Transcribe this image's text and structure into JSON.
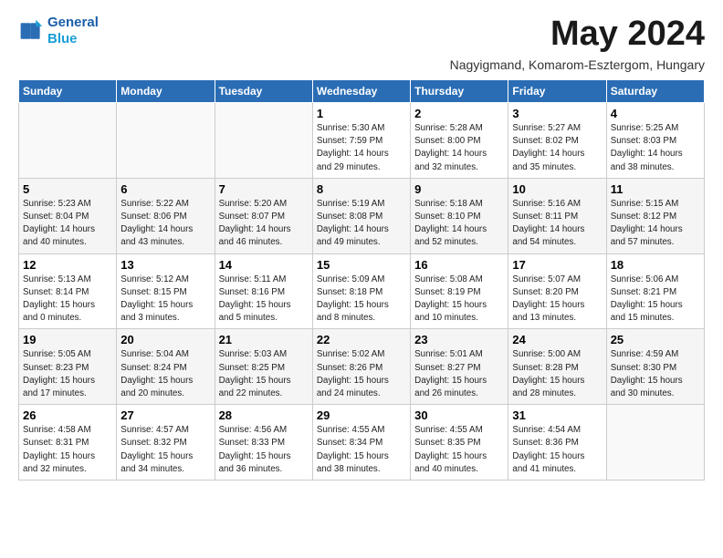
{
  "header": {
    "logo_line1": "General",
    "logo_line2": "Blue",
    "title": "May 2024",
    "subtitle": "Nagyigmand, Komarom-Esztergom, Hungary"
  },
  "days_of_week": [
    "Sunday",
    "Monday",
    "Tuesday",
    "Wednesday",
    "Thursday",
    "Friday",
    "Saturday"
  ],
  "weeks": [
    [
      {
        "day": "",
        "info": ""
      },
      {
        "day": "",
        "info": ""
      },
      {
        "day": "",
        "info": ""
      },
      {
        "day": "1",
        "info": "Sunrise: 5:30 AM\nSunset: 7:59 PM\nDaylight: 14 hours\nand 29 minutes."
      },
      {
        "day": "2",
        "info": "Sunrise: 5:28 AM\nSunset: 8:00 PM\nDaylight: 14 hours\nand 32 minutes."
      },
      {
        "day": "3",
        "info": "Sunrise: 5:27 AM\nSunset: 8:02 PM\nDaylight: 14 hours\nand 35 minutes."
      },
      {
        "day": "4",
        "info": "Sunrise: 5:25 AM\nSunset: 8:03 PM\nDaylight: 14 hours\nand 38 minutes."
      }
    ],
    [
      {
        "day": "5",
        "info": "Sunrise: 5:23 AM\nSunset: 8:04 PM\nDaylight: 14 hours\nand 40 minutes."
      },
      {
        "day": "6",
        "info": "Sunrise: 5:22 AM\nSunset: 8:06 PM\nDaylight: 14 hours\nand 43 minutes."
      },
      {
        "day": "7",
        "info": "Sunrise: 5:20 AM\nSunset: 8:07 PM\nDaylight: 14 hours\nand 46 minutes."
      },
      {
        "day": "8",
        "info": "Sunrise: 5:19 AM\nSunset: 8:08 PM\nDaylight: 14 hours\nand 49 minutes."
      },
      {
        "day": "9",
        "info": "Sunrise: 5:18 AM\nSunset: 8:10 PM\nDaylight: 14 hours\nand 52 minutes."
      },
      {
        "day": "10",
        "info": "Sunrise: 5:16 AM\nSunset: 8:11 PM\nDaylight: 14 hours\nand 54 minutes."
      },
      {
        "day": "11",
        "info": "Sunrise: 5:15 AM\nSunset: 8:12 PM\nDaylight: 14 hours\nand 57 minutes."
      }
    ],
    [
      {
        "day": "12",
        "info": "Sunrise: 5:13 AM\nSunset: 8:14 PM\nDaylight: 15 hours\nand 0 minutes."
      },
      {
        "day": "13",
        "info": "Sunrise: 5:12 AM\nSunset: 8:15 PM\nDaylight: 15 hours\nand 3 minutes."
      },
      {
        "day": "14",
        "info": "Sunrise: 5:11 AM\nSunset: 8:16 PM\nDaylight: 15 hours\nand 5 minutes."
      },
      {
        "day": "15",
        "info": "Sunrise: 5:09 AM\nSunset: 8:18 PM\nDaylight: 15 hours\nand 8 minutes."
      },
      {
        "day": "16",
        "info": "Sunrise: 5:08 AM\nSunset: 8:19 PM\nDaylight: 15 hours\nand 10 minutes."
      },
      {
        "day": "17",
        "info": "Sunrise: 5:07 AM\nSunset: 8:20 PM\nDaylight: 15 hours\nand 13 minutes."
      },
      {
        "day": "18",
        "info": "Sunrise: 5:06 AM\nSunset: 8:21 PM\nDaylight: 15 hours\nand 15 minutes."
      }
    ],
    [
      {
        "day": "19",
        "info": "Sunrise: 5:05 AM\nSunset: 8:23 PM\nDaylight: 15 hours\nand 17 minutes."
      },
      {
        "day": "20",
        "info": "Sunrise: 5:04 AM\nSunset: 8:24 PM\nDaylight: 15 hours\nand 20 minutes."
      },
      {
        "day": "21",
        "info": "Sunrise: 5:03 AM\nSunset: 8:25 PM\nDaylight: 15 hours\nand 22 minutes."
      },
      {
        "day": "22",
        "info": "Sunrise: 5:02 AM\nSunset: 8:26 PM\nDaylight: 15 hours\nand 24 minutes."
      },
      {
        "day": "23",
        "info": "Sunrise: 5:01 AM\nSunset: 8:27 PM\nDaylight: 15 hours\nand 26 minutes."
      },
      {
        "day": "24",
        "info": "Sunrise: 5:00 AM\nSunset: 8:28 PM\nDaylight: 15 hours\nand 28 minutes."
      },
      {
        "day": "25",
        "info": "Sunrise: 4:59 AM\nSunset: 8:30 PM\nDaylight: 15 hours\nand 30 minutes."
      }
    ],
    [
      {
        "day": "26",
        "info": "Sunrise: 4:58 AM\nSunset: 8:31 PM\nDaylight: 15 hours\nand 32 minutes."
      },
      {
        "day": "27",
        "info": "Sunrise: 4:57 AM\nSunset: 8:32 PM\nDaylight: 15 hours\nand 34 minutes."
      },
      {
        "day": "28",
        "info": "Sunrise: 4:56 AM\nSunset: 8:33 PM\nDaylight: 15 hours\nand 36 minutes."
      },
      {
        "day": "29",
        "info": "Sunrise: 4:55 AM\nSunset: 8:34 PM\nDaylight: 15 hours\nand 38 minutes."
      },
      {
        "day": "30",
        "info": "Sunrise: 4:55 AM\nSunset: 8:35 PM\nDaylight: 15 hours\nand 40 minutes."
      },
      {
        "day": "31",
        "info": "Sunrise: 4:54 AM\nSunset: 8:36 PM\nDaylight: 15 hours\nand 41 minutes."
      },
      {
        "day": "",
        "info": ""
      }
    ]
  ]
}
